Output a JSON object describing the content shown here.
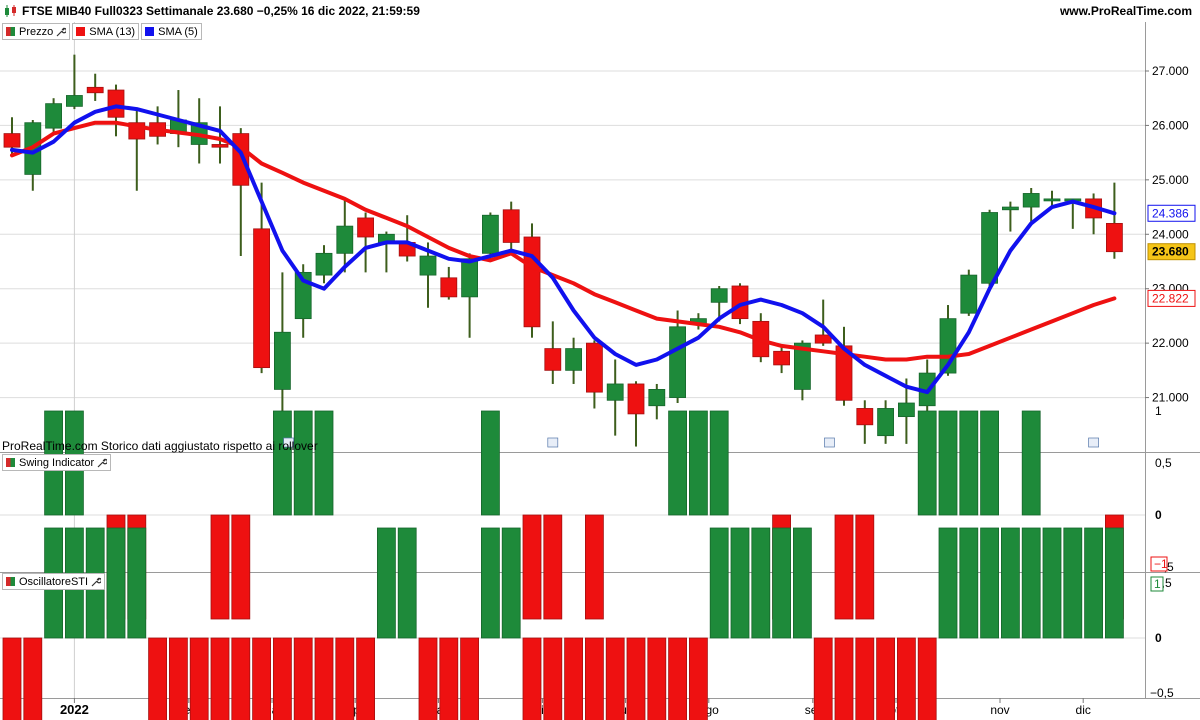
{
  "header": {
    "title": "FTSE MIB40 Full0323 Settimanale 23.680 −0,25% 16 dic 2022, 21:59:59",
    "site": "www.ProRealTime.com"
  },
  "legend_main": [
    {
      "label": "Prezzo",
      "swatch": "price"
    },
    {
      "label": "SMA (13)",
      "swatch": "red"
    },
    {
      "label": "SMA (5)",
      "swatch": "blue"
    }
  ],
  "legend_swing": "Swing Indicator",
  "legend_osc": "OscillatoreSTI",
  "note": "ProRealTime.com Storico dati aggiustato rispetto ai rollover",
  "colors": {
    "up": "#1e8a3a",
    "down": "#ee1111",
    "sma13": "#ee1111",
    "sma5": "#1111ee",
    "grid": "#dddddd",
    "price_badge": "#f5c518"
  },
  "chart_data": {
    "type": "candlestick",
    "x_labels": [
      "2022",
      "feb",
      "mar",
      "apr",
      "mag",
      "giu",
      "lug",
      "ago",
      "set",
      "ott",
      "nov",
      "dic"
    ],
    "x_label_index": [
      3,
      8.5,
      12.5,
      16.5,
      20.5,
      25.5,
      29.5,
      33.5,
      38.5,
      42.5,
      47.5,
      51.5
    ],
    "price_axis": {
      "ylim": [
        20000,
        27900
      ],
      "ticks": [
        "21.000",
        "22.000",
        "23.000",
        "24.000",
        "25.000",
        "26.000",
        "27.000"
      ],
      "tick_values": [
        21000,
        22000,
        23000,
        24000,
        25000,
        26000,
        27000
      ]
    },
    "badges": [
      {
        "text": "24.386",
        "value": 24386,
        "color": "blue"
      },
      {
        "text": "23.680",
        "value": 23680,
        "color": "gold"
      },
      {
        "text": "22.822",
        "value": 22822,
        "color": "red"
      }
    ],
    "candles": [
      {
        "o": 25850,
        "h": 26150,
        "l": 25450,
        "c": 25600
      },
      {
        "o": 25100,
        "h": 26100,
        "l": 24800,
        "c": 26050
      },
      {
        "o": 25950,
        "h": 26500,
        "l": 25850,
        "c": 26400
      },
      {
        "o": 26350,
        "h": 27300,
        "l": 26300,
        "c": 26550
      },
      {
        "o": 26700,
        "h": 26950,
        "l": 26450,
        "c": 26600
      },
      {
        "o": 26650,
        "h": 26750,
        "l": 25800,
        "c": 26150
      },
      {
        "o": 26050,
        "h": 26300,
        "l": 24800,
        "c": 25750
      },
      {
        "o": 26050,
        "h": 26350,
        "l": 25650,
        "c": 25800
      },
      {
        "o": 25850,
        "h": 26650,
        "l": 25600,
        "c": 26100
      },
      {
        "o": 25650,
        "h": 26500,
        "l": 25300,
        "c": 26050
      },
      {
        "o": 25650,
        "h": 26350,
        "l": 25300,
        "c": 25600
      },
      {
        "o": 25850,
        "h": 25950,
        "l": 23600,
        "c": 24900
      },
      {
        "o": 24100,
        "h": 24950,
        "l": 21450,
        "c": 21550
      },
      {
        "o": 21150,
        "h": 23300,
        "l": 20200,
        "c": 22200
      },
      {
        "o": 22450,
        "h": 23450,
        "l": 22100,
        "c": 23300
      },
      {
        "o": 23250,
        "h": 23800,
        "l": 23100,
        "c": 23650
      },
      {
        "o": 23650,
        "h": 24650,
        "l": 23300,
        "c": 24150
      },
      {
        "o": 24300,
        "h": 24400,
        "l": 23300,
        "c": 23950
      },
      {
        "o": 23850,
        "h": 24050,
        "l": 23300,
        "c": 24000
      },
      {
        "o": 23850,
        "h": 24350,
        "l": 23500,
        "c": 23600
      },
      {
        "o": 23250,
        "h": 23850,
        "l": 22650,
        "c": 23600
      },
      {
        "o": 23200,
        "h": 23400,
        "l": 22800,
        "c": 22850
      },
      {
        "o": 22850,
        "h": 23650,
        "l": 22100,
        "c": 23550
      },
      {
        "o": 23650,
        "h": 24400,
        "l": 23500,
        "c": 24350
      },
      {
        "o": 24450,
        "h": 24600,
        "l": 23650,
        "c": 23850
      },
      {
        "o": 23950,
        "h": 24200,
        "l": 22100,
        "c": 22300
      },
      {
        "o": 21900,
        "h": 22400,
        "l": 21250,
        "c": 21500
      },
      {
        "o": 21500,
        "h": 22100,
        "l": 21250,
        "c": 21900
      },
      {
        "o": 22000,
        "h": 22050,
        "l": 20800,
        "c": 21100
      },
      {
        "o": 20950,
        "h": 21700,
        "l": 20300,
        "c": 21250
      },
      {
        "o": 21250,
        "h": 21300,
        "l": 20100,
        "c": 20700
      },
      {
        "o": 20850,
        "h": 21250,
        "l": 20600,
        "c": 21150
      },
      {
        "o": 21000,
        "h": 22600,
        "l": 20900,
        "c": 22300
      },
      {
        "o": 22350,
        "h": 22550,
        "l": 22250,
        "c": 22450
      },
      {
        "o": 22750,
        "h": 23050,
        "l": 22400,
        "c": 23000
      },
      {
        "o": 23050,
        "h": 23100,
        "l": 22350,
        "c": 22450
      },
      {
        "o": 22400,
        "h": 22550,
        "l": 21650,
        "c": 21750
      },
      {
        "o": 21850,
        "h": 21950,
        "l": 21450,
        "c": 21600
      },
      {
        "o": 21150,
        "h": 22050,
        "l": 20950,
        "c": 22000
      },
      {
        "o": 22150,
        "h": 22800,
        "l": 21950,
        "c": 22000
      },
      {
        "o": 21950,
        "h": 22300,
        "l": 20850,
        "c": 20950
      },
      {
        "o": 20800,
        "h": 20950,
        "l": 20150,
        "c": 20500
      },
      {
        "o": 20300,
        "h": 20950,
        "l": 20150,
        "c": 20800
      },
      {
        "o": 20650,
        "h": 21350,
        "l": 20150,
        "c": 20900
      },
      {
        "o": 20850,
        "h": 21700,
        "l": 20750,
        "c": 21450
      },
      {
        "o": 21450,
        "h": 22700,
        "l": 21400,
        "c": 22450
      },
      {
        "o": 22550,
        "h": 23350,
        "l": 22500,
        "c": 23250
      },
      {
        "o": 23100,
        "h": 24450,
        "l": 23000,
        "c": 24400
      },
      {
        "o": 24450,
        "h": 24600,
        "l": 24050,
        "c": 24500
      },
      {
        "o": 24500,
        "h": 24850,
        "l": 24200,
        "c": 24750
      },
      {
        "o": 24650,
        "h": 24800,
        "l": 24500,
        "c": 24650
      },
      {
        "o": 24650,
        "h": 24650,
        "l": 24100,
        "c": 24650
      },
      {
        "o": 24650,
        "h": 24750,
        "l": 24000,
        "c": 24300
      },
      {
        "o": 24200,
        "h": 24950,
        "l": 23550,
        "c": 23680
      }
    ],
    "sma13": [
      25450,
      25600,
      25850,
      25950,
      26050,
      26050,
      25980,
      25920,
      25870,
      25820,
      25750,
      25600,
      25300,
      25130,
      24950,
      24800,
      24650,
      24450,
      24300,
      24150,
      23950,
      23750,
      23600,
      23520,
      23650,
      23400,
      23250,
      23100,
      22900,
      22750,
      22600,
      22450,
      22400,
      22350,
      22300,
      22200,
      22050,
      21950,
      21900,
      21850,
      21800,
      21750,
      21700,
      21700,
      21750,
      21750,
      21800,
      21950,
      22100,
      22250,
      22400,
      22550,
      22700,
      22822
    ],
    "sma5": [
      25550,
      25500,
      25700,
      26050,
      26250,
      26350,
      26300,
      26200,
      26100,
      26000,
      25900,
      25500,
      24600,
      23700,
      23150,
      23000,
      23400,
      23750,
      23850,
      23850,
      23700,
      23550,
      23500,
      23600,
      23700,
      23600,
      23200,
      22600,
      22100,
      21800,
      21600,
      21700,
      21900,
      22100,
      22450,
      22700,
      22800,
      22700,
      22550,
      22300,
      21900,
      21600,
      21400,
      21200,
      21100,
      21600,
      22200,
      23000,
      23700,
      24200,
      24500,
      24600,
      24500,
      24386
    ],
    "swing_axis": {
      "ylim": [
        -1.1,
        1.1
      ],
      "ticks": [
        "1",
        "0,5",
        "0",
        "−0,5"
      ],
      "tick_values": [
        1,
        0.5,
        0,
        -0.5
      ],
      "badge": "−1"
    },
    "swing": [
      0,
      0,
      1,
      1,
      0,
      -1,
      -1,
      0,
      0,
      0,
      -1,
      -1,
      0,
      1,
      1,
      1,
      0,
      0,
      0,
      0,
      0,
      0,
      0,
      1,
      0,
      -1,
      -1,
      0,
      -1,
      0,
      0,
      0,
      1,
      1,
      1,
      0,
      0,
      -1,
      0,
      0,
      -1,
      -1,
      0,
      0,
      1,
      1,
      1,
      1,
      0,
      1,
      0,
      0,
      0,
      -1
    ],
    "osc_axis": {
      "ylim": [
        -1.1,
        1.1
      ],
      "ticks": [
        "0,5",
        "0",
        "−0,5"
      ],
      "tick_values": [
        0.5,
        0,
        -0.5
      ],
      "badge": "1"
    },
    "osc": [
      -1,
      -1,
      1,
      1,
      1,
      1,
      1,
      -1,
      -1,
      -1,
      -1,
      -1,
      -1,
      -1,
      -1,
      -1,
      -1,
      -1,
      1,
      1,
      -1,
      -1,
      -1,
      1,
      1,
      -1,
      -1,
      -1,
      -1,
      -1,
      -1,
      -1,
      -1,
      -1,
      1,
      1,
      1,
      1,
      1,
      -1,
      -1,
      -1,
      -1,
      -1,
      -1,
      1,
      1,
      1,
      1,
      1,
      1,
      1,
      1,
      1
    ]
  }
}
